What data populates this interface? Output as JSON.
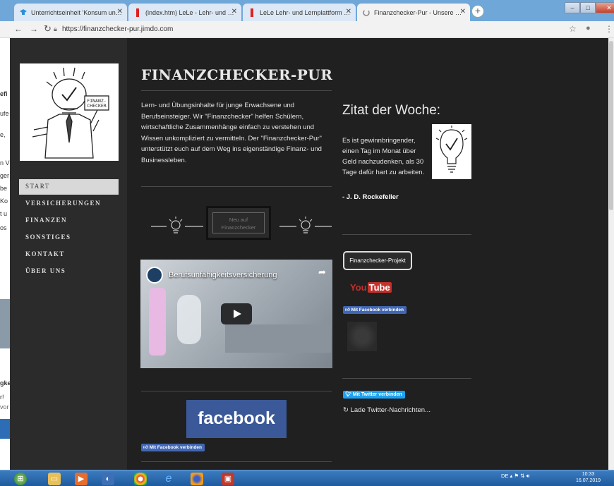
{
  "browser": {
    "tabs": [
      {
        "label": "Unterrichtseinheit 'Konsum und ...",
        "icon": "graduation-cap-icon",
        "color": "#2c8fd6"
      },
      {
        "label": "(index.htm) LeLe - Lehr- und Lern...",
        "icon": "red-bookmark-icon",
        "color": "#d22"
      },
      {
        "label": "LeLe Lehr- und Lernplattform für ...",
        "icon": "red-bookmark-icon",
        "color": "#d22"
      },
      {
        "label": "Finanzchecker-Pur - Unsere Web...",
        "icon": "loading-icon",
        "color": "#888",
        "active": true
      }
    ],
    "new_tab": "+",
    "url": "https://finanzchecker-pur.jimdo.com",
    "window_controls": [
      "–",
      "□",
      "✕"
    ]
  },
  "left_fragments": [
    "efi",
    "ufe",
    "e,",
    "n V",
    "ger",
    "be",
    "Ko",
    "t u",
    "os",
    "gke",
    "r!",
    "vor"
  ],
  "sidebar": {
    "nav": [
      {
        "label": "START",
        "active": true
      },
      {
        "label": "VERSICHERUNGEN"
      },
      {
        "label": "FINANZEN"
      },
      {
        "label": "SONSTIGES"
      },
      {
        "label": "KONTAKT"
      },
      {
        "label": "ÜBER UNS"
      }
    ],
    "logo_sign": "FINANZ-CHECKER"
  },
  "main": {
    "title": "FINANZCHECKER-PUR",
    "intro": "Lern- und Übungsinhalte für junge Erwachsene und Berufseinsteiger. Wir \"Finanzchecker\" helfen Schülern, wirtschaftliche Zusammenhänge einfach zu verstehen und Wissen unkompliziert zu vermitteln. Der \"Finanzchecker-Pur\" unterstützt euch auf dem Weg ins eigenständige Finanz- und Businessleben.",
    "neu_label": "Neu auf Finanzchecker",
    "video_title": "Berufsunfähigkeitsversicherung",
    "facebook_banner": "facebook",
    "fb_connect": "Mit Facebook verbinden"
  },
  "quote": {
    "heading": "Zitat der Woche:",
    "text": "Es ist gewinnbringender, einen Tag im Monat über Geld nachzudenken, als 30 Tage dafür hart zu arbeiten.",
    "author": "- J. D. Rockefeller"
  },
  "right_column": {
    "project_button": "Finanzchecker-Projekt",
    "youtube_you": "You",
    "youtube_tube": "Tube",
    "fb_connect": "Mit Facebook verbinden",
    "twitter_connect": "Mit Twitter verbinden",
    "twitter_loading": "Lade Twitter-Nachrichten..."
  },
  "taskbar": {
    "tray_lang": "DE",
    "time": "10:33",
    "date": "16.07.2019"
  }
}
